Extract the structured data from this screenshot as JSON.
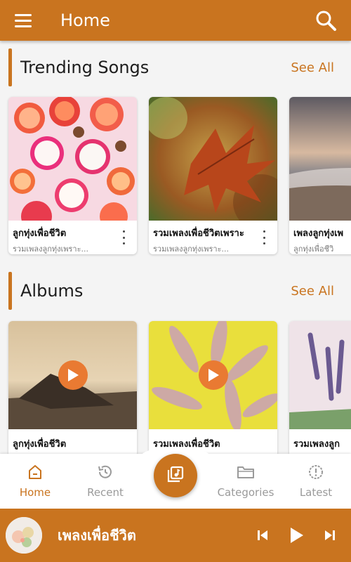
{
  "header": {
    "title": "Home",
    "menu_icon": "hamburger-menu-icon",
    "search_icon": "search-icon"
  },
  "trending": {
    "title": "Trending Songs",
    "see_all": "See All",
    "items": [
      {
        "title": "ลูกทุ่งเพื่อชีวิต",
        "subtitle": "รวมเพลงลูกทุ่งเพราะ..."
      },
      {
        "title": "รวมเพลงเพื่อชีวิตเพราะ",
        "subtitle": "รวมเพลงลูกทุ่งเพราะ..."
      },
      {
        "title": "เพลงลูกทุ่งเพ",
        "subtitle": "ลูกทุ่งเพื่อชีวิ"
      }
    ]
  },
  "albums": {
    "title": "Albums",
    "see_all": "See All",
    "items": [
      {
        "title": "ลูกทุ่งเพื่อชีวิต"
      },
      {
        "title": "รวมเพลงเพื่อชีวิต"
      },
      {
        "title": "รวมเพลงลูก"
      }
    ]
  },
  "bottom_nav": {
    "items": [
      {
        "label": "Home",
        "icon": "home-icon",
        "active": true
      },
      {
        "label": "Recent",
        "icon": "history-icon",
        "active": false
      },
      {
        "label": "Categories",
        "icon": "folder-icon",
        "active": false
      },
      {
        "label": "Latest",
        "icon": "alert-clock-icon",
        "active": false
      }
    ],
    "center_icon": "music-library-icon"
  },
  "player": {
    "song_title": "เพลงเพื่อชีวิต"
  },
  "colors": {
    "accent": "#c9741f",
    "play": "#e97a32",
    "inactive": "#9a9a9a"
  }
}
